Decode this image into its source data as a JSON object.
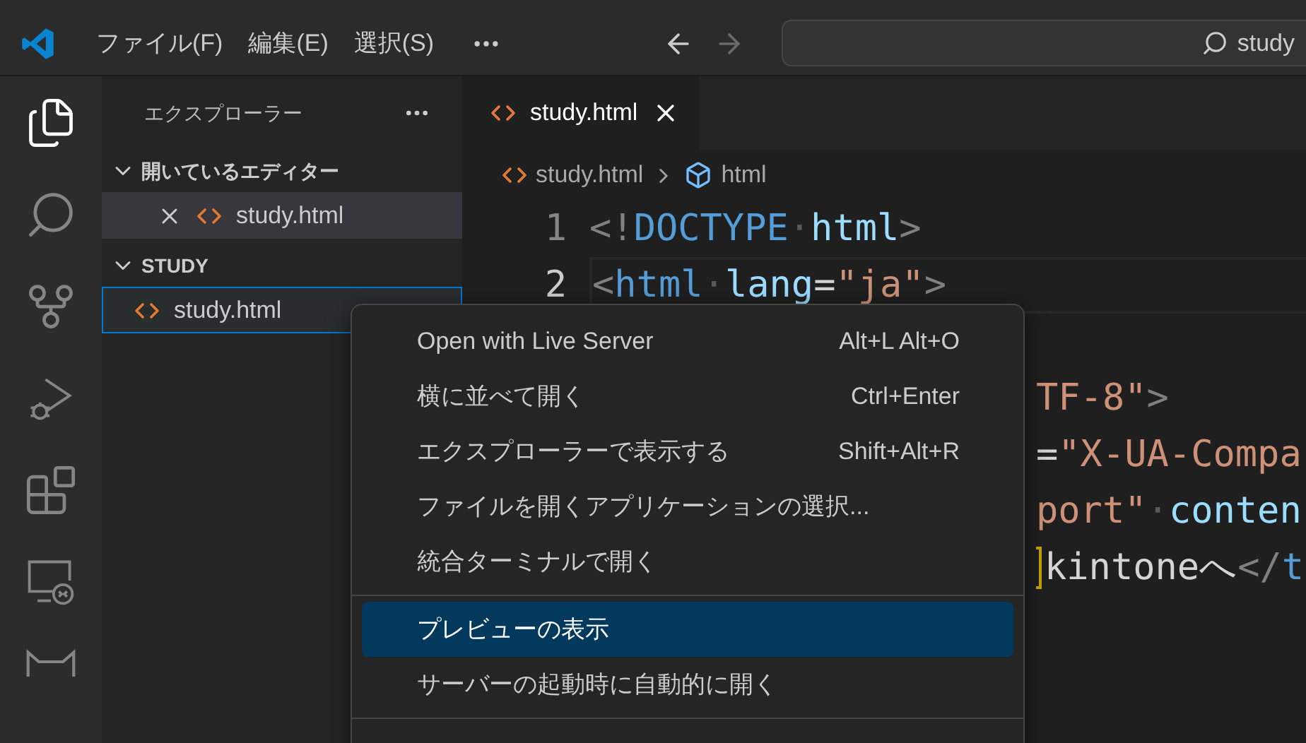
{
  "title_bar": {
    "menus": [
      "ファイル(F)",
      "編集(E)",
      "選択(S)"
    ],
    "back_enabled": true,
    "forward_enabled": false,
    "search": {
      "value": "study"
    }
  },
  "activity_bar": [
    {
      "kind": "explorer",
      "selected": true
    },
    {
      "kind": "search",
      "selected": false
    },
    {
      "kind": "source-control",
      "selected": false
    },
    {
      "kind": "run-debug",
      "selected": false
    },
    {
      "kind": "extensions",
      "selected": false
    },
    {
      "kind": "remote",
      "selected": false
    },
    {
      "kind": "cat",
      "selected": false
    }
  ],
  "sidebar": {
    "title": "エクスプローラー",
    "sections": [
      {
        "title": "開いているエディター",
        "expanded": true,
        "items": [
          {
            "name": "study.html",
            "closable": true,
            "selected": false,
            "active": true
          }
        ]
      },
      {
        "title": "STUDY",
        "expanded": true,
        "items": [
          {
            "name": "study.html",
            "closable": false,
            "selected": true,
            "active": false
          }
        ]
      }
    ]
  },
  "editor": {
    "tabs": [
      {
        "label": "study.html",
        "selected": true
      }
    ],
    "breadcrumb": [
      "study.html",
      "html"
    ],
    "lines": [
      {
        "number": "1",
        "tokens": [
          {
            "kind": "punct",
            "text": "<!"
          },
          {
            "kind": "keyword",
            "text": "DOCTYPE"
          },
          {
            "kind": "space",
            "text": "·"
          },
          {
            "kind": "attr",
            "text": "html"
          },
          {
            "kind": "punct",
            "text": ">"
          }
        ]
      },
      {
        "number": "2",
        "current": true,
        "tokens": [
          {
            "kind": "punct",
            "text": "<"
          },
          {
            "kind": "keyword",
            "text": "html"
          },
          {
            "kind": "space",
            "text": "·"
          },
          {
            "kind": "attr",
            "text": "lang"
          },
          {
            "kind": "plain",
            "text": "="
          },
          {
            "kind": "string",
            "text": "\"ja\""
          },
          {
            "kind": "punct",
            "text": ">"
          }
        ]
      },
      {
        "tokens": [
          {
            "kind": "string",
            "text": "TF-8\""
          },
          {
            "kind": "punct",
            "text": ">"
          }
        ]
      },
      {
        "tokens": [
          {
            "kind": "plain",
            "text": "="
          },
          {
            "kind": "string",
            "text": "\"X-UA-Compa"
          }
        ]
      },
      {
        "tokens": [
          {
            "kind": "string",
            "text": "port\""
          },
          {
            "kind": "space",
            "text": "·"
          },
          {
            "kind": "attr",
            "text": "conten"
          }
        ]
      },
      {
        "flagged_before": true,
        "tokens": [
          {
            "kind": "plain",
            "text": "kintoneへ"
          },
          {
            "kind": "punct",
            "text": "</"
          },
          {
            "kind": "keyword",
            "text": "t"
          }
        ]
      }
    ]
  },
  "context_menu": [
    {
      "kind": "item",
      "label": "Open with Live Server",
      "shortcut": "Alt+L Alt+O",
      "selected": false
    },
    {
      "kind": "item",
      "label": "横に並べて開く",
      "shortcut": "Ctrl+Enter",
      "selected": false
    },
    {
      "kind": "item",
      "label": "エクスプローラーで表示する",
      "shortcut": "Shift+Alt+R",
      "selected": false
    },
    {
      "kind": "item",
      "label": "ファイルを開くアプリケーションの選択...",
      "selected": false
    },
    {
      "kind": "item",
      "label": "統合ターミナルで開く",
      "selected": false
    },
    {
      "kind": "separator"
    },
    {
      "kind": "item",
      "label": "プレビューの表示",
      "selected": true
    },
    {
      "kind": "item",
      "label": "サーバーの起動時に自動的に開く",
      "selected": false
    },
    {
      "kind": "separator"
    }
  ]
}
